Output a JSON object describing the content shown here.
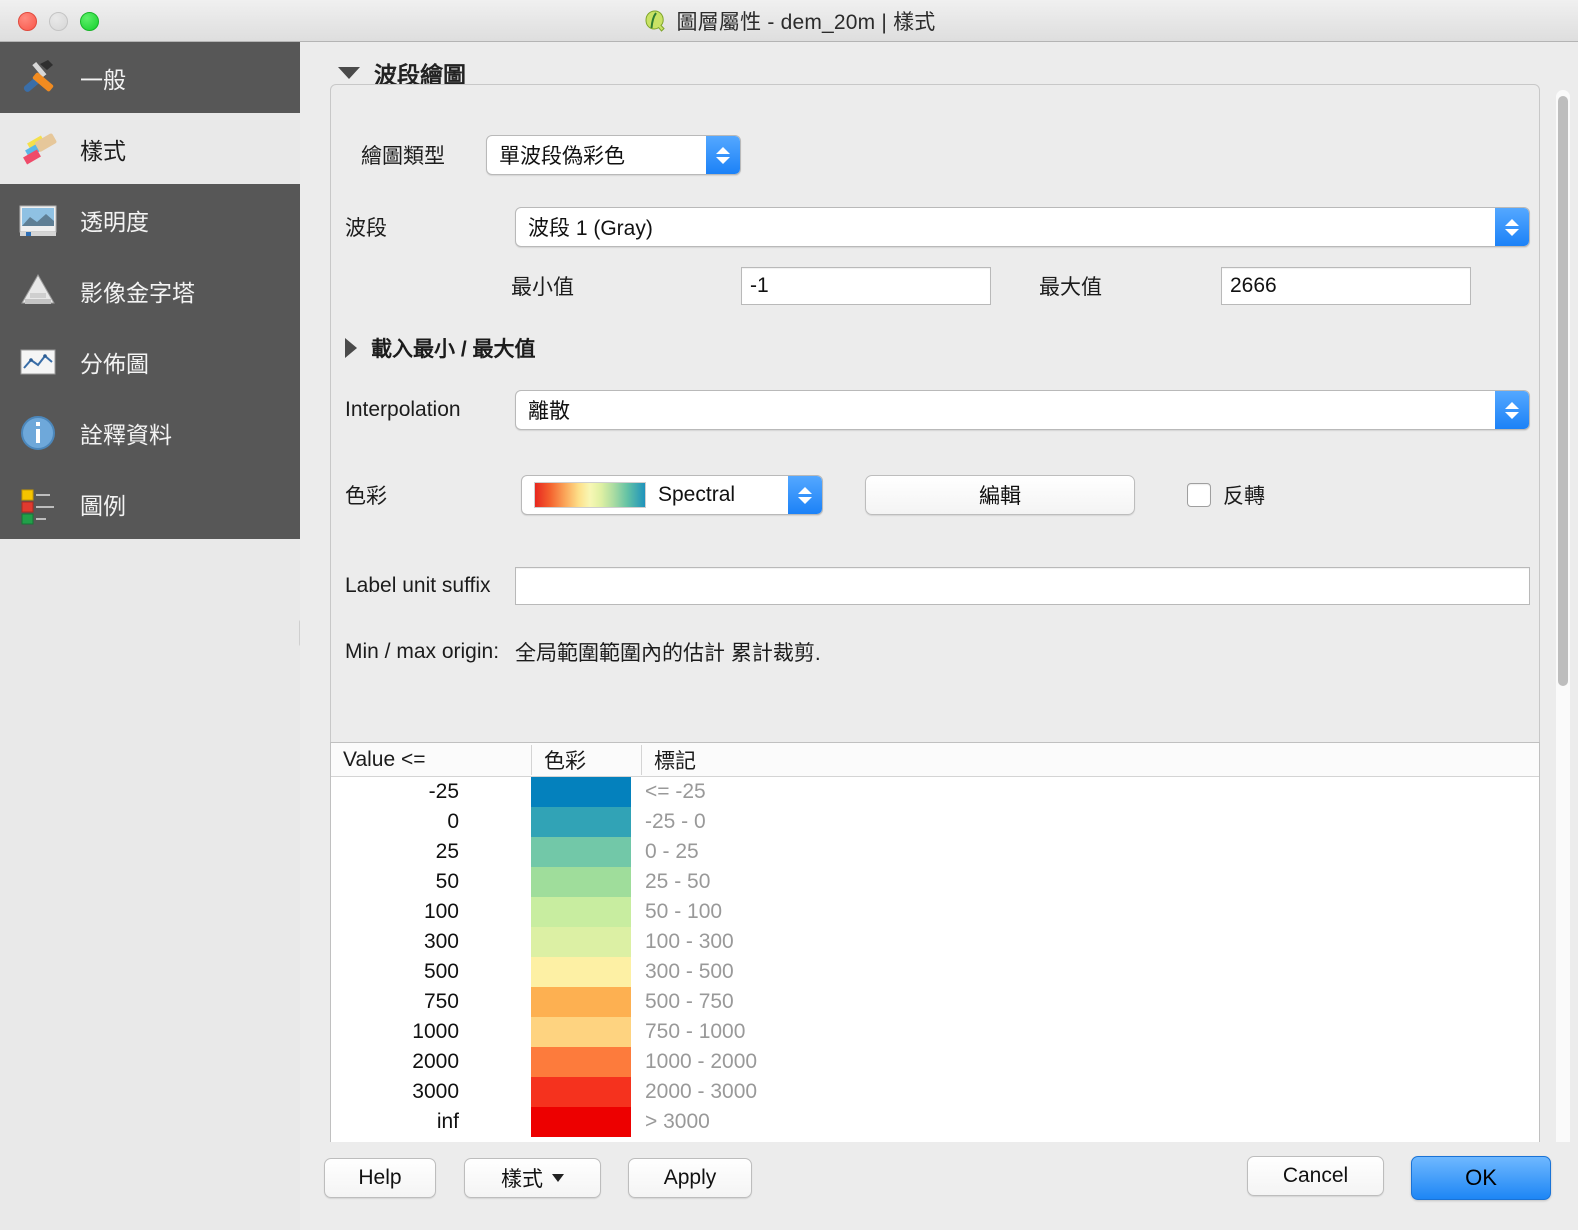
{
  "titlebar": {
    "title": "圖層屬性 - dem_20m | 樣式",
    "logo_icon": "qgis-logo-icon",
    "close_icon": "close-window-button",
    "minimize_icon": "minimize-window-button",
    "zoom_icon": "zoom-window-button"
  },
  "sidebar": {
    "items": [
      {
        "label": "一般",
        "icon": "tools-icon",
        "selected": true
      },
      {
        "label": "樣式",
        "icon": "paintbrush-icon",
        "selected": false
      },
      {
        "label": "透明度",
        "icon": "transparency-icon",
        "selected": true
      },
      {
        "label": "影像金字塔",
        "icon": "pyramid-icon",
        "selected": true
      },
      {
        "label": "分佈圖",
        "icon": "histogram-icon",
        "selected": true
      },
      {
        "label": "詮釋資料",
        "icon": "info-icon",
        "selected": true
      },
      {
        "label": "圖例",
        "icon": "legend-icon",
        "selected": true
      }
    ]
  },
  "main": {
    "section_title": "波段繪圖",
    "render_type_label": "繪圖類型",
    "render_type_value": "單波段偽彩色",
    "band_label": "波段",
    "band_value": "波段 1 (Gray)",
    "min_label": "最小值",
    "min_value": "-1",
    "max_label": "最大值",
    "max_value": "2666",
    "load_minmax_label": "載入最小 / 最大值",
    "interpolation_label": "Interpolation",
    "interpolation_value": "離散",
    "color_label": "色彩",
    "ramp_name": "Spectral",
    "edit_button": "編輯",
    "invert_label": "反轉",
    "label_unit_suffix_label": "Label unit suffix",
    "label_unit_suffix_value": "",
    "minmax_origin_label": "Min / max origin:",
    "minmax_origin_value": "全局範圍範圍內的估計 累計裁剪."
  },
  "table": {
    "headers": [
      "Value <=",
      "色彩",
      "標記"
    ],
    "rows": [
      {
        "value": "-25",
        "color": "#0481bd",
        "label": "<= -25"
      },
      {
        "value": "0",
        "color": "#31a3b6",
        "label": "-25 - 0"
      },
      {
        "value": "25",
        "color": "#72c8a8",
        "label": "0 - 25"
      },
      {
        "value": "50",
        "color": "#9fdd9b",
        "label": "25 - 50"
      },
      {
        "value": "100",
        "color": "#c8eda0",
        "label": "50 - 100"
      },
      {
        "value": "300",
        "color": "#dcf0a4",
        "label": "100 - 300"
      },
      {
        "value": "500",
        "color": "#fdf0a4",
        "label": "300 - 500"
      },
      {
        "value": "750",
        "color": "#fdb051",
        "label": "500 - 750"
      },
      {
        "value": "1000",
        "color": "#fed380",
        "label": "750 - 1000"
      },
      {
        "value": "2000",
        "color": "#fd7b3c",
        "label": "1000 - 2000"
      },
      {
        "value": "3000",
        "color": "#f5321e",
        "label": "2000 - 3000"
      },
      {
        "value": "inf",
        "color": "#ed0000",
        "label": "> 3000"
      }
    ]
  },
  "buttons": {
    "help": "Help",
    "style": "樣式",
    "apply": "Apply",
    "cancel": "Cancel",
    "ok": "OK"
  },
  "colors": {
    "accent_blue": "#1d86f5",
    "selected_sidebar": "#575757",
    "window_bg": "#ececec"
  }
}
